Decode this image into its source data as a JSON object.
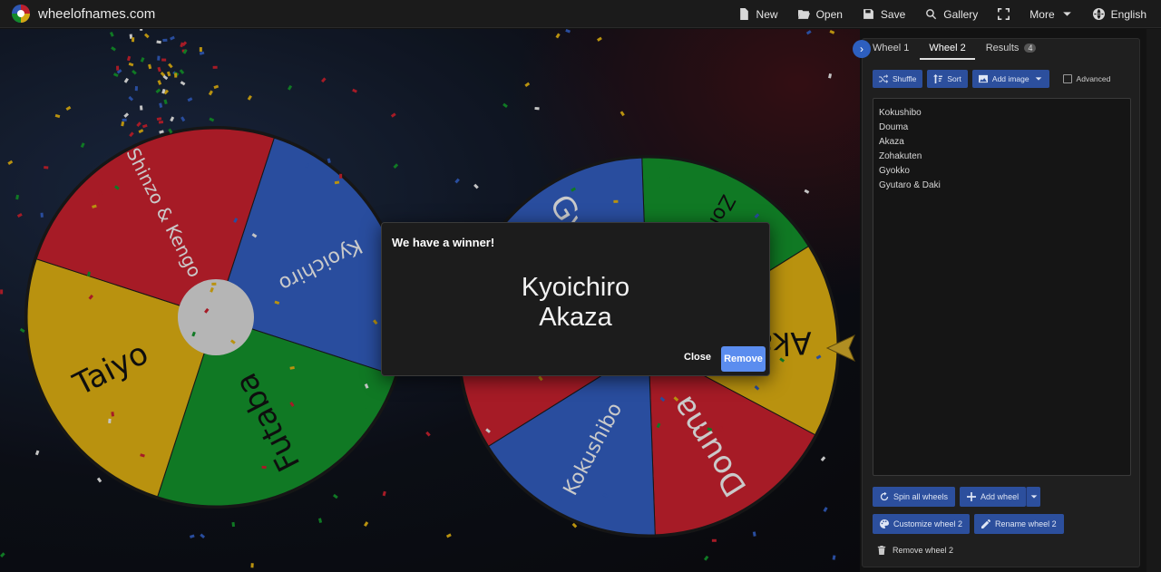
{
  "brand": {
    "name": "wheelofnames.com"
  },
  "nav": [
    {
      "label": "New",
      "icon": "file-icon"
    },
    {
      "label": "Open",
      "icon": "folder-open-icon"
    },
    {
      "label": "Save",
      "icon": "floppy-icon"
    },
    {
      "label": "Gallery",
      "icon": "search-icon"
    },
    {
      "label": "",
      "icon": "fullscreen-icon"
    },
    {
      "label": "More",
      "icon": "chevron-down-icon"
    },
    {
      "label": "English",
      "icon": "globe-icon"
    }
  ],
  "wheel1": {
    "segments": [
      {
        "label": "Kyoichiro",
        "color": "#2f58b4"
      },
      {
        "label": "Futaba",
        "color": "#138a2a"
      },
      {
        "label": "Taiyo",
        "color": "#d3a712"
      },
      {
        "label": "Shinzo & Kengo",
        "color": "#be1f2c"
      }
    ]
  },
  "wheel2": {
    "segments": [
      {
        "label": "Zohakuten",
        "color": "#138a2a"
      },
      {
        "label": "Akaza",
        "color": "#d3a712"
      },
      {
        "label": "Douma",
        "color": "#be1f2c"
      },
      {
        "label": "Kokushibo",
        "color": "#2f58b4"
      },
      {
        "label": "Gyutaro & Daki",
        "color": "#be1f2c"
      },
      {
        "label": "Gyokko",
        "color": "#2f58b4"
      }
    ]
  },
  "panel": {
    "tabs": {
      "wheel1": "Wheel 1",
      "wheel2": "Wheel 2",
      "results": "Results",
      "results_count": "4"
    },
    "toolbar": {
      "shuffle": "Shuffle",
      "sort": "Sort",
      "add_image": "Add image",
      "advanced": "Advanced"
    },
    "entries": [
      "Kokushibo",
      "Douma",
      "Akaza",
      "Zohakuten",
      "Gyokko",
      "Gyutaro & Daki"
    ],
    "actions": {
      "spin_all": "Spin all wheels",
      "add_wheel": "Add wheel",
      "customize": "Customize wheel 2",
      "rename": "Rename wheel 2",
      "remove": "Remove wheel 2"
    }
  },
  "modal": {
    "title": "We have a winner!",
    "winners": [
      "Kyoichiro",
      "Akaza"
    ],
    "close_label": "Close",
    "remove_label": "Remove"
  },
  "colors": {
    "accent": "#2c4f9d",
    "remove_button": "#5b8def",
    "pointer": "#c9a227"
  }
}
